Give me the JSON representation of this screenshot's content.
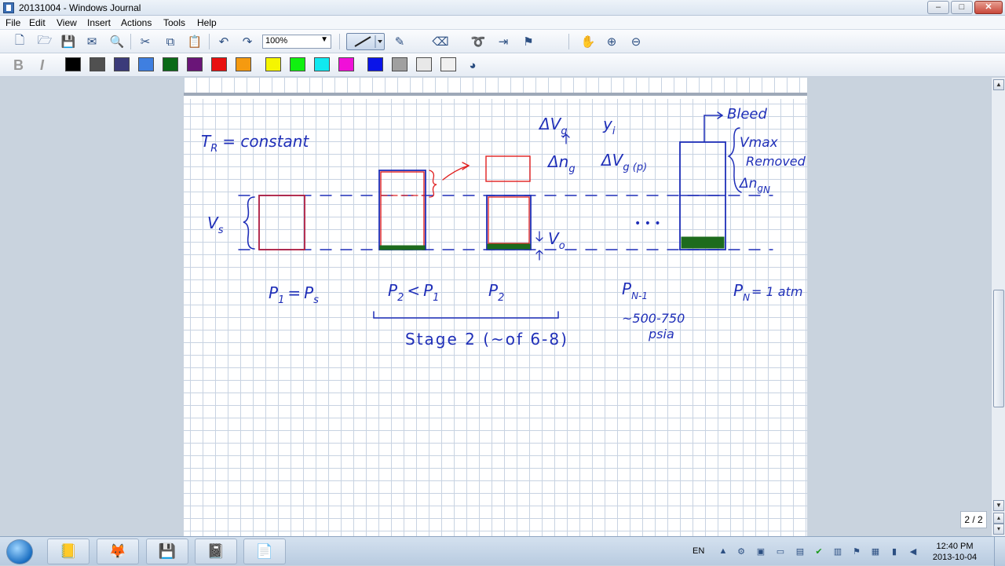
{
  "window": {
    "title": "20131004 - Windows Journal"
  },
  "menu": [
    "File",
    "Edit",
    "View",
    "Insert",
    "Actions",
    "Tools",
    "Help"
  ],
  "toolbar": {
    "zoom": "100%",
    "icons": [
      "new-note-icon",
      "open-icon",
      "save-icon",
      "send-email-icon",
      "search-icon",
      "cut-icon",
      "copy-icon",
      "paste-icon",
      "undo-icon",
      "redo-icon",
      "pen-icon",
      "highlighter-icon",
      "eraser-icon",
      "lasso-icon",
      "insert-space-icon",
      "flag-icon",
      "pan-hand-icon",
      "zoom-in-icon",
      "zoom-out-icon"
    ]
  },
  "format": {
    "bold": "B",
    "italic": "I"
  },
  "palette": [
    "#000000",
    "#505050",
    "#3b3b7a",
    "#3f7fe0",
    "#0b6b18",
    "#6a1578",
    "#e81010",
    "#f59a10",
    "#f5f500",
    "#10f010",
    "#10e8f0",
    "#f010d8",
    "#0a14e8",
    "#a0a0a0",
    "#e8e8e8",
    "#f0f0f0"
  ],
  "notes": {
    "t_r": "T",
    "t_r_sub": "R",
    "t_r_rest": "= constant",
    "v_s": "V",
    "v_s_sub": "s",
    "delta_vg": "ΔV",
    "delta_vg_sub": "g",
    "y_i": "y",
    "y_i_sub": "i",
    "delta_ng": "Δn",
    "delta_ng_sub": "g",
    "delta_vgp": "ΔV",
    "delta_vgp_sub": "g (p)",
    "v_0": "V",
    "v_0_sub": "o",
    "ellipsis": "• • •",
    "bleed": "Bleed",
    "v_max": "Vmax",
    "removed": "Removed",
    "delta_ngn": "Δn",
    "delta_ngn_sub": "g",
    "delta_ngn_subsub": "N",
    "p1_eq": "P",
    "p1_eq_mid": "=",
    "p1_sub": "1",
    "ps_sub": "s",
    "p2_lt": "P",
    "p2_sub": "2",
    "lt": "<",
    "p1b": "P",
    "p1b_sub": "1",
    "p2b": "P",
    "p2b_sub": "2",
    "pn1": "P",
    "pn1_sub": "N-1",
    "range": "~500-750",
    "psia": "psia",
    "pn": "P",
    "pn_sub": "N",
    "pn_rest": "= 1 atm",
    "stage": "Stage 2 (~of 6-8)"
  },
  "page_counter": "2 / 2",
  "taskbar": {
    "apps": [
      "journal-notes-icon",
      "firefox-icon",
      "save-disk-icon",
      "journal-app-icon",
      "pdf-icon"
    ],
    "language": "EN",
    "time": "12:40 PM",
    "date": "2013-10-04"
  }
}
